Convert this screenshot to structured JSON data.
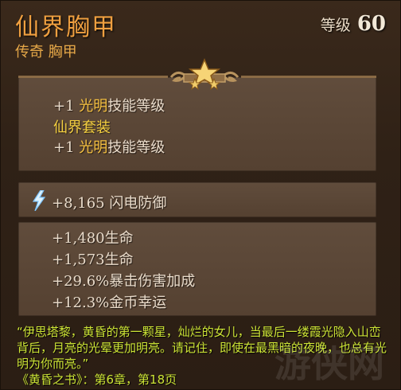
{
  "item": {
    "name": "仙界胸甲",
    "type": "传奇 胸甲",
    "level_label": "等级",
    "level_value": "60"
  },
  "bonus_block": {
    "line1_prefix": "+1",
    "line1_skill": "光明",
    "line1_suffix": "技能等级",
    "set_name": "仙界套装",
    "line2_prefix": "+1",
    "line2_skill": "光明",
    "line2_suffix": "技能等级"
  },
  "primary_stat": {
    "icon": "lightning-icon",
    "value": "+8,165",
    "label": "闪电防御"
  },
  "stats": [
    {
      "value": "+1,480",
      "label": "生命"
    },
    {
      "value": "+1,573",
      "label": "生命"
    },
    {
      "value": "+29.6%",
      "label": "暴击伤害加成"
    },
    {
      "value": "+12.3%",
      "label": "金币幸运"
    }
  ],
  "lore": {
    "quote": "“伊思塔黎，黄昏的第一颗星，灿烂的女儿，当最后一缕霞光隐入山峦背后，月亮的光晕更加明亮。请记住，即使在最黑暗的夜晚，也总有光明为你而亮。”",
    "source": "《黄昏之书》：第6章，第18页"
  },
  "watermark": "游侠网",
  "colors": {
    "item_name": "#f0a040",
    "skill_highlight": "#f5c040",
    "lore_text": "#cde436",
    "panel_bg": "#5a4534"
  }
}
